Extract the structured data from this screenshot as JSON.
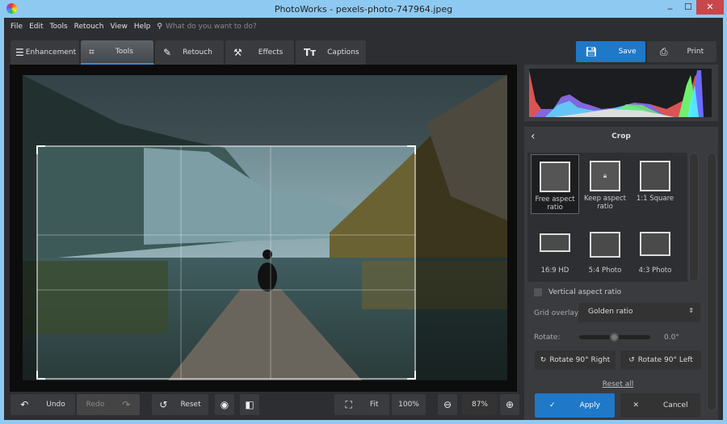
{
  "window": {
    "title": "PhotoWorks - pexels-photo-747964.jpeg",
    "minimize": "‒",
    "maximize": "☐",
    "close": "✕"
  },
  "menu": {
    "items": [
      "File",
      "Edit",
      "Tools",
      "Retouch",
      "View",
      "Help"
    ],
    "search_placeholder": "What do you want to do?"
  },
  "tabs": [
    {
      "label": "Enhancement",
      "icon": "sliders-icon"
    },
    {
      "label": "Tools",
      "icon": "crop-icon"
    },
    {
      "label": "Retouch",
      "icon": "brush-icon"
    },
    {
      "label": "Effects",
      "icon": "magic-wand-icon"
    },
    {
      "label": "Captions",
      "icon": "text-icon"
    }
  ],
  "toolbar": {
    "save": "Save",
    "print": "Print"
  },
  "crop": {
    "title": "Crop",
    "options": [
      {
        "label": "Free aspect ratio"
      },
      {
        "label": "Keep aspect ratio"
      },
      {
        "label": "1:1 Square"
      },
      {
        "label": "16:9 HD"
      },
      {
        "label": "5:4 Photo"
      },
      {
        "label": "4:3 Photo"
      }
    ],
    "vertical_label": "Vertical aspect ratio",
    "vertical_checked": false,
    "grid_label": "Grid overlay:",
    "grid_value": "Golden ratio",
    "rotate_label": "Rotate:",
    "rotate_value": "0.0°",
    "rotate_right": "Rotate 90° Right",
    "rotate_left": "Rotate 90° Left",
    "reset_all": "Reset all",
    "apply": "Apply",
    "cancel": "Cancel"
  },
  "bottom": {
    "undo": "Undo",
    "redo": "Redo",
    "reset": "Reset",
    "fit": "Fit",
    "zoom100": "100%",
    "zoom": "87%"
  },
  "colors": {
    "accent": "#1f78c8",
    "bg": "#2d2e31",
    "close": "#c9474a"
  }
}
